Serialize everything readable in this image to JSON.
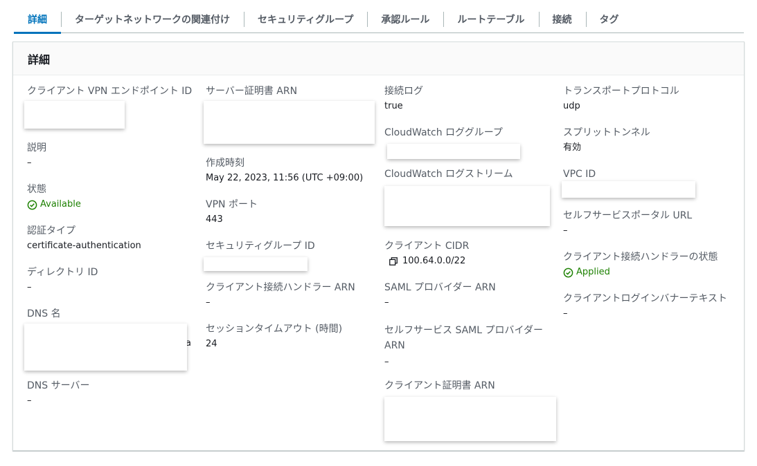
{
  "tabs": [
    {
      "label": "詳細",
      "active": true
    },
    {
      "label": "ターゲットネットワークの関連付け",
      "active": false
    },
    {
      "label": "セキュリティグループ",
      "active": false
    },
    {
      "label": "承認ルール",
      "active": false
    },
    {
      "label": "ルートテーブル",
      "active": false
    },
    {
      "label": "接続",
      "active": false
    },
    {
      "label": "タグ",
      "active": false
    }
  ],
  "panel": {
    "title": "詳細"
  },
  "fields": {
    "endpoint_id": {
      "label": "クライアント VPN エンドポイント ID"
    },
    "description": {
      "label": "説明",
      "value": "–"
    },
    "state": {
      "label": "状態",
      "value": "Available"
    },
    "auth_type": {
      "label": "認証タイプ",
      "value": "certificate-authentication"
    },
    "directory_id": {
      "label": "ディレクトリ ID",
      "value": "–"
    },
    "dns_name": {
      "label": "DNS 名",
      "peek": "a"
    },
    "dns_servers": {
      "label": "DNS サーバー",
      "value": "–"
    },
    "server_cert_arn": {
      "label": "サーバー証明書 ARN"
    },
    "created": {
      "label": "作成時刻",
      "value": "May 22, 2023, 11:56 (UTC +09:00)"
    },
    "vpn_port": {
      "label": "VPN ポート",
      "value": "443"
    },
    "security_group_id": {
      "label": "セキュリティグループ ID"
    },
    "handler_arn": {
      "label": "クライアント接続ハンドラー ARN",
      "value": "–"
    },
    "session_timeout": {
      "label": "セッションタイムアウト (時間)",
      "value": "24"
    },
    "connection_log": {
      "label": "接続ログ",
      "value": "true"
    },
    "cw_log_group": {
      "label": "CloudWatch ロググループ"
    },
    "cw_log_stream": {
      "label": "CloudWatch ログストリーム"
    },
    "client_cidr": {
      "label": "クライアント CIDR",
      "value": "100.64.0.0/22"
    },
    "saml_arn": {
      "label": "SAML プロバイダー ARN",
      "value": "–"
    },
    "selfservice_saml_arn": {
      "label": "セルフサービス SAML プロバイダー ARN",
      "value": "–"
    },
    "client_cert_arn": {
      "label": "クライアント証明書 ARN"
    },
    "transport": {
      "label": "トランスポートプロトコル",
      "value": "udp"
    },
    "split_tunnel": {
      "label": "スプリットトンネル",
      "value": "有効"
    },
    "vpc_id": {
      "label": "VPC ID"
    },
    "selfservice_url": {
      "label": "セルフサービスポータル URL",
      "value": "–"
    },
    "handler_state": {
      "label": "クライアント接続ハンドラーの状態",
      "value": "Applied"
    },
    "banner_text": {
      "label": "クライアントログインバナーテキスト",
      "value": "–"
    }
  },
  "colors": {
    "accent": "#0073bb",
    "success": "#1d8102"
  },
  "icons": {
    "status": "check-circle-icon",
    "copy": "copy-icon"
  }
}
